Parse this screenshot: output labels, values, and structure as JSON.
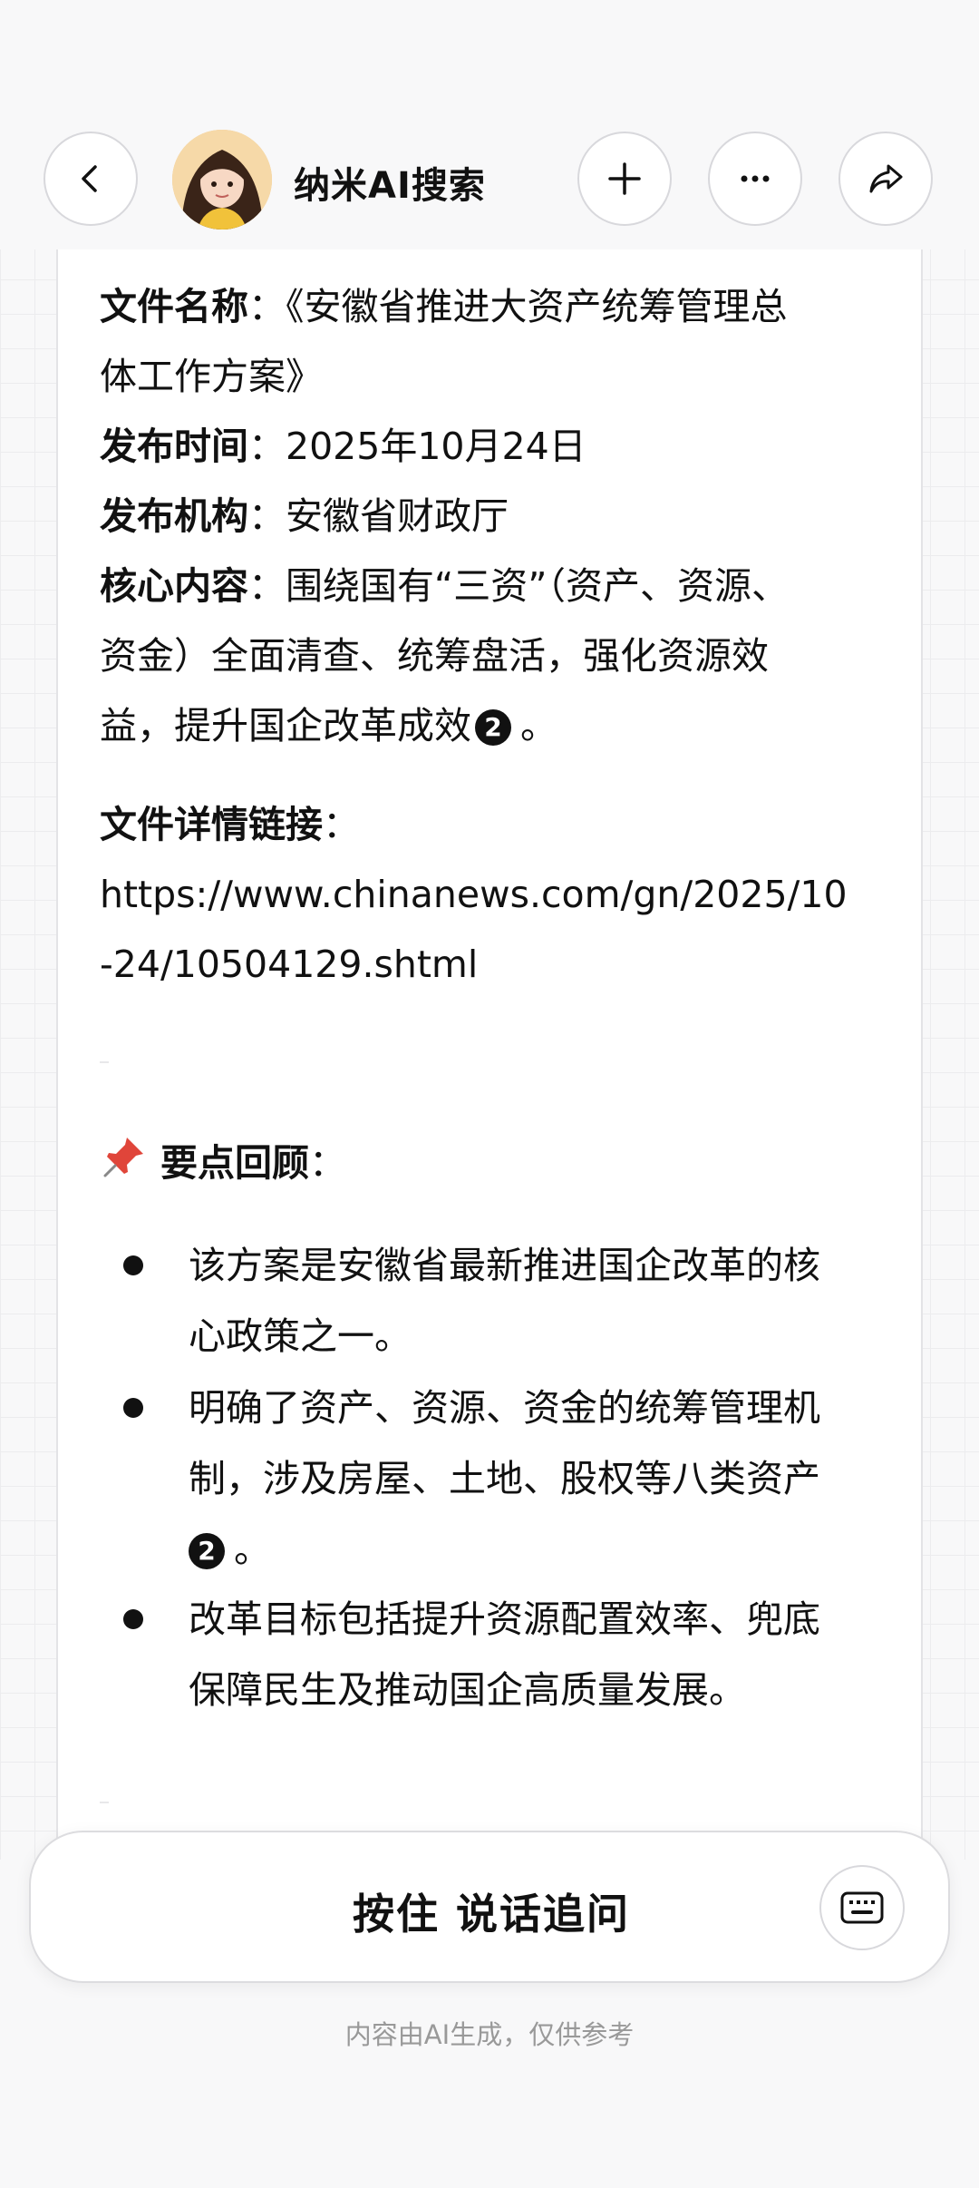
{
  "header": {
    "title": "纳米AI搜索"
  },
  "document": {
    "name_label": "文件名称",
    "name_value_line1": "：《安徽省推进大资产统筹管理总",
    "name_value_line2": "体工作方案》",
    "date_label": "发布时间",
    "date_value": "：2025年10月24日",
    "org_label": "发布机构",
    "org_value": "：安徽省财政厅",
    "core_label": "核心内容",
    "core_line1": "：围绕国有“三资”（资产、资源、",
    "core_line2": "资金）全面清查、统筹盘活，强化资源效",
    "core_line3": "益，提升国企改革成效",
    "core_cite": "2",
    "core_end": "。",
    "link_label": "文件详情链接",
    "link_colon": "：",
    "link_line1": "https://www.chinanews.com/gn/2025/10",
    "link_line2": "-24/10504129.shtml"
  },
  "summary": {
    "icon": "pushpin-icon",
    "title": "要点回顾",
    "colon": "：",
    "bullets": [
      {
        "lines": [
          "该方案是安徽省最新推进国企改革的核",
          "心政策之一。"
        ]
      },
      {
        "lines": [
          "明确了资产、资源、资金的统筹管理机",
          "制，涉及房屋、土地、股权等八类资产"
        ],
        "cite": "2",
        "end": "。"
      },
      {
        "lines": [
          "改革目标包括提升资源配置效率、兜底",
          "保障民生及推动国企高质量发展。"
        ]
      }
    ]
  },
  "input_bar": {
    "voice_label": "按住 说话追问"
  },
  "footer": {
    "disclaimer": "内容由AI生成，仅供参考"
  }
}
